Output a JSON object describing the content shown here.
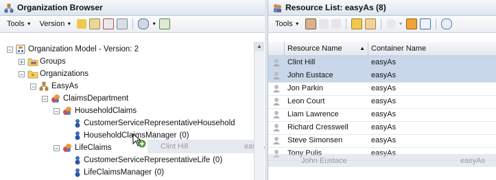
{
  "left_panel": {
    "title": "Organization Browser",
    "toolbar": {
      "tools_label": "Tools",
      "version_label": "Version"
    },
    "tree": {
      "root": "Organization Model - Version: 2",
      "groups": "Groups",
      "organizations": "Organizations",
      "easyas": "EasyAs",
      "claims_department": "ClaimsDepartment",
      "household_claims": "HouseholdClaims",
      "csr_household": "CustomerServiceRepresentativeHousehold",
      "household_claims_manager": "HouseholdClaimsManager",
      "household_claims_manager_count": "(0)",
      "life_claims": "LifeClaims",
      "csr_life": "CustomerServiceRepresentativeLife",
      "csr_life_count": "(0)",
      "life_claims_manager": "LifeClaimsManager",
      "life_claims_manager_count": "(0)"
    }
  },
  "right_panel": {
    "title": "Resource List: easyAs (8)",
    "toolbar": {
      "tools_label": "Tools"
    },
    "columns": {
      "resource_name": "Resource Name",
      "container_name": "Container Name"
    },
    "rows": [
      {
        "name": "Clint Hill",
        "container": "easyAs"
      },
      {
        "name": "John Eustace",
        "container": "easyAs"
      },
      {
        "name": "Jon Parkin",
        "container": "easyAs"
      },
      {
        "name": "Leon Court",
        "container": "easyAs"
      },
      {
        "name": "Liam Lawrence",
        "container": "easyAs"
      },
      {
        "name": "Richard Cresswell",
        "container": "easyAs"
      },
      {
        "name": "Steve Simonsen",
        "container": "easyAs"
      },
      {
        "name": "Tony Pulis",
        "container": "easyAs"
      }
    ]
  },
  "drag_ghost": {
    "row1_name": "Clint Hill",
    "row1_container": "easyAs",
    "row2_name": "John Eustace",
    "row2_container": "easyAs"
  }
}
